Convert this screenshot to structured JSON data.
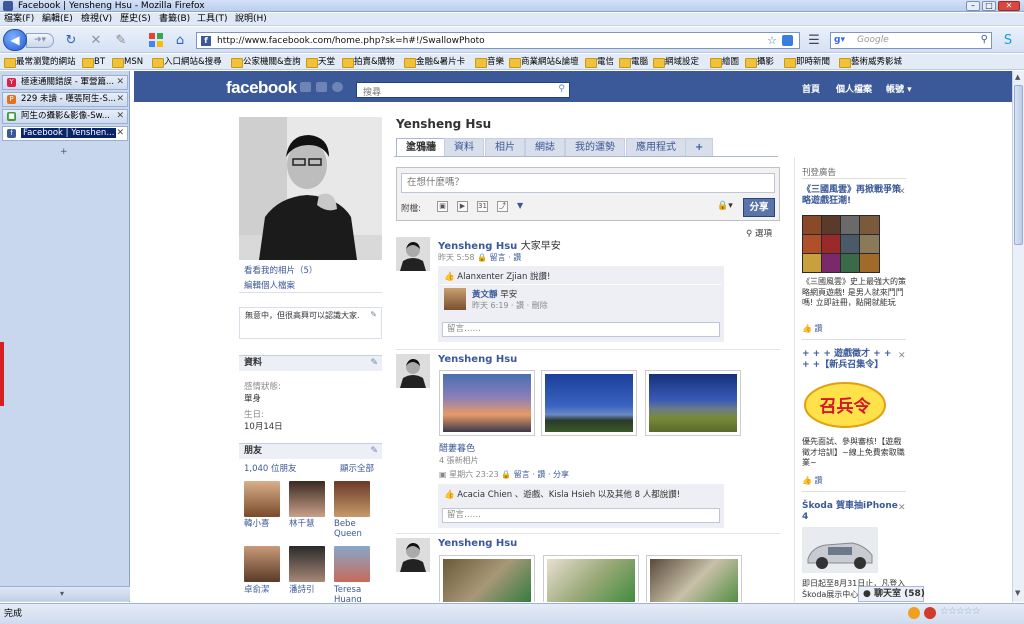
{
  "window": {
    "title": "Facebook | Yensheng Hsu - Mozilla Firefox"
  },
  "menu": [
    "檔案(F)",
    "編輯(E)",
    "檢視(V)",
    "歷史(S)",
    "書籤(B)",
    "工具(T)",
    "說明(H)"
  ],
  "url": "http://www.facebook.com/home.php?sk=h#!/SwallowPhoto",
  "search_placeholder": "Google",
  "bookmarks": [
    "最常瀏覽的網站",
    "BT",
    "MSN",
    "入口網站&搜尋",
    "公家機關&查詢",
    "天堂",
    "拍賣&購物",
    "金融&暑片卡",
    "音樂",
    "商業網站&論壇",
    "電信",
    "電腦",
    "網域設定",
    "繪圖",
    "攝影",
    "即時新聞",
    "藝術威秀影城"
  ],
  "tabs": [
    {
      "label": "極速通關錯誤 - 軍營篇...",
      "active": false
    },
    {
      "label": "229 未讀 - 嘆張阿生-S...",
      "active": false
    },
    {
      "label": "阿生の攝影&影像-Sw...",
      "active": false
    },
    {
      "label": "Facebook | Yenshen...",
      "active": true
    }
  ],
  "fb": {
    "logo": "facebook",
    "search_placeholder": "搜尋",
    "nav": [
      "首頁",
      "個人檔案",
      "帳號 ▾"
    ],
    "profile_name": "Yensheng Hsu",
    "left_links": [
      "看看我的相片（5）",
      "編輯個人檔案"
    ],
    "bio": "無意中，但很高興可以認識大家.",
    "info_heading": "資料",
    "relationship_label": "感情狀態:",
    "relationship_value": "單身",
    "birthday_label": "生日:",
    "birthday_value": "10月14日",
    "friends_heading": "朋友",
    "friends_count": "1,040 位朋友",
    "friends_show_all": "顯示全部",
    "friends": [
      "韓小喜",
      "林千慧",
      "Bebe Queen",
      "卓俞潔",
      "潘詩引",
      "Teresa Huang"
    ],
    "profile_tabs": [
      "塗鴉牆",
      "資料",
      "相片",
      "網誌",
      "我的運勢",
      "應用程式",
      "+"
    ],
    "composer_placeholder": "在想什麼嗎？",
    "attach_label": "附檔:",
    "share_button": "分享",
    "options_label": "選項",
    "posts": [
      {
        "author": "Yensheng Hsu",
        "message": "大家早安",
        "meta_time": "昨天 5:58",
        "meta_actions": "留言 · 讚",
        "likes": "Alanxenter Zjian 說讚!",
        "comment_author": "黃文靜",
        "comment_text": "早安",
        "comment_meta": "昨天 6:19 · 讚 · 刪除",
        "comment_placeholder": "留言……"
      },
      {
        "author": "Yensheng Hsu",
        "album_title": "醋蔞暮色",
        "album_count": "4 張新相片",
        "meta_time": "星期六 23:23",
        "meta_actions": "留言 · 讚 · 分享",
        "likes": "Acacia Chien 、遊戲、Kisla Hsieh 以及其他 8 人都說讚!",
        "comment_placeholder": "留言……"
      },
      {
        "author": "Yensheng Hsu"
      }
    ],
    "ads_title": "刊登廣告",
    "ads": [
      {
        "title": "《三國風雲》再掀戰爭策略遊戲狂潮!",
        "text": "《三國風雲》史上最強大的策略網頁遊戲! 是男人就來鬥鬥嗎! 立即註冊，點開就能玩",
        "like": "讚"
      },
      {
        "title": "+ + + 遊戲徵才 + + + +【新兵召集令】",
        "text": "優先面試、參與審核!【遊戲徵才培訓】~線上免費索取職業~",
        "like": "讚"
      },
      {
        "title": "Škoda 賀車抽iPhone 4",
        "text": "即日起至8月31日止，凡登入Škoda展示中心…",
        "like": ""
      }
    ],
    "ad2_graphic_text": "召兵令",
    "chat_label": "聊天室 (58)"
  },
  "status": "完成"
}
